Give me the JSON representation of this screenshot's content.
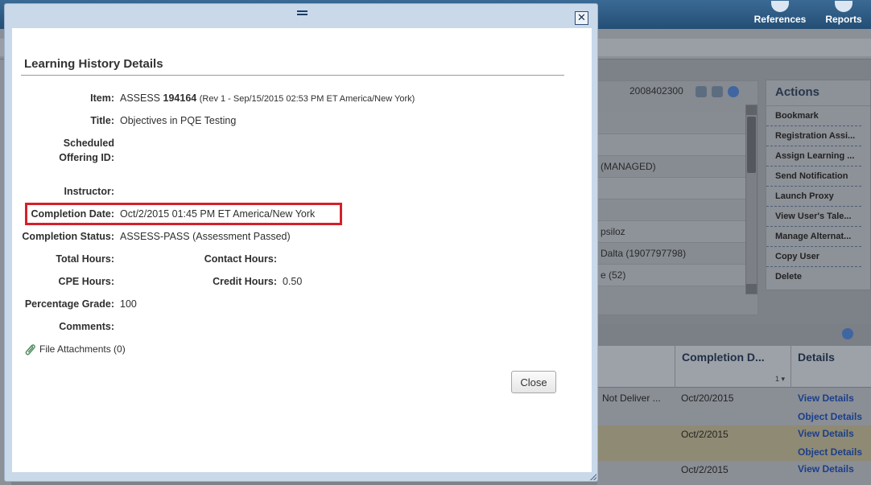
{
  "background": {
    "topbar": {
      "references_label": "References",
      "reports_label": "Reports"
    },
    "user_panel": {
      "id": "2008402300",
      "rows": [
        "",
        "",
        "(MANAGED)",
        "",
        "",
        "psiloz",
        "Dalta (1907797798)",
        "e (52)"
      ]
    },
    "actions": {
      "title": "Actions",
      "items": [
        "Bookmark",
        "Registration Assi...",
        "Assign Learning ...",
        "Send Notification",
        "Launch Proxy",
        "View User's Tale...",
        "Manage Alternat...",
        "Copy User",
        "Delete"
      ]
    },
    "grid": {
      "col_completion": "Completion D...",
      "col_details": "Details",
      "sort_indicator": "1 ▾",
      "row1_status": "Not Deliver ...",
      "row1_date": "Oct/20/2015",
      "row2_date": "Oct/2/2015",
      "row3_date": "Oct/2/2015",
      "view_details": "View Details",
      "object_details": "Object Details"
    }
  },
  "dialog": {
    "title": "Learning History Details",
    "fields": {
      "item_label": "Item:",
      "item_type": "ASSESS",
      "item_id": "194164",
      "item_rev": "(Rev 1 - Sep/15/2015 02:53 PM ET America/New York)",
      "title_label": "Title:",
      "title_value": "Objectives in PQE Testing",
      "scheduled_label_1": "Scheduled",
      "scheduled_label_2": "Offering ID:",
      "scheduled_value": "",
      "instructor_label": "Instructor:",
      "instructor_value": "",
      "completion_date_label": "Completion Date:",
      "completion_date_value": "Oct/2/2015 01:45 PM ET America/New York",
      "completion_status_label": "Completion Status:",
      "completion_status_value": "ASSESS-PASS (Assessment Passed)",
      "total_hours_label": "Total Hours:",
      "total_hours_value": "",
      "contact_hours_label": "Contact Hours:",
      "contact_hours_value": "",
      "cpe_hours_label": "CPE Hours:",
      "cpe_hours_value": "",
      "credit_hours_label": "Credit Hours:",
      "credit_hours_value": "0.50",
      "percentage_grade_label": "Percentage Grade:",
      "percentage_grade_value": "100",
      "comments_label": "Comments:",
      "comments_value": ""
    },
    "attachments_label": "File Attachments (0)",
    "close_button": "Close",
    "close_icon": "✕"
  },
  "colors": {
    "highlight_border": "#d5202a",
    "dialog_frame": "#c9d9ea",
    "link_blue": "#1b3f8a"
  },
  "icons": [
    "references-icon",
    "reports-icon",
    "close-icon",
    "paperclip-icon",
    "help-icon",
    "drag-handle-icon"
  ]
}
